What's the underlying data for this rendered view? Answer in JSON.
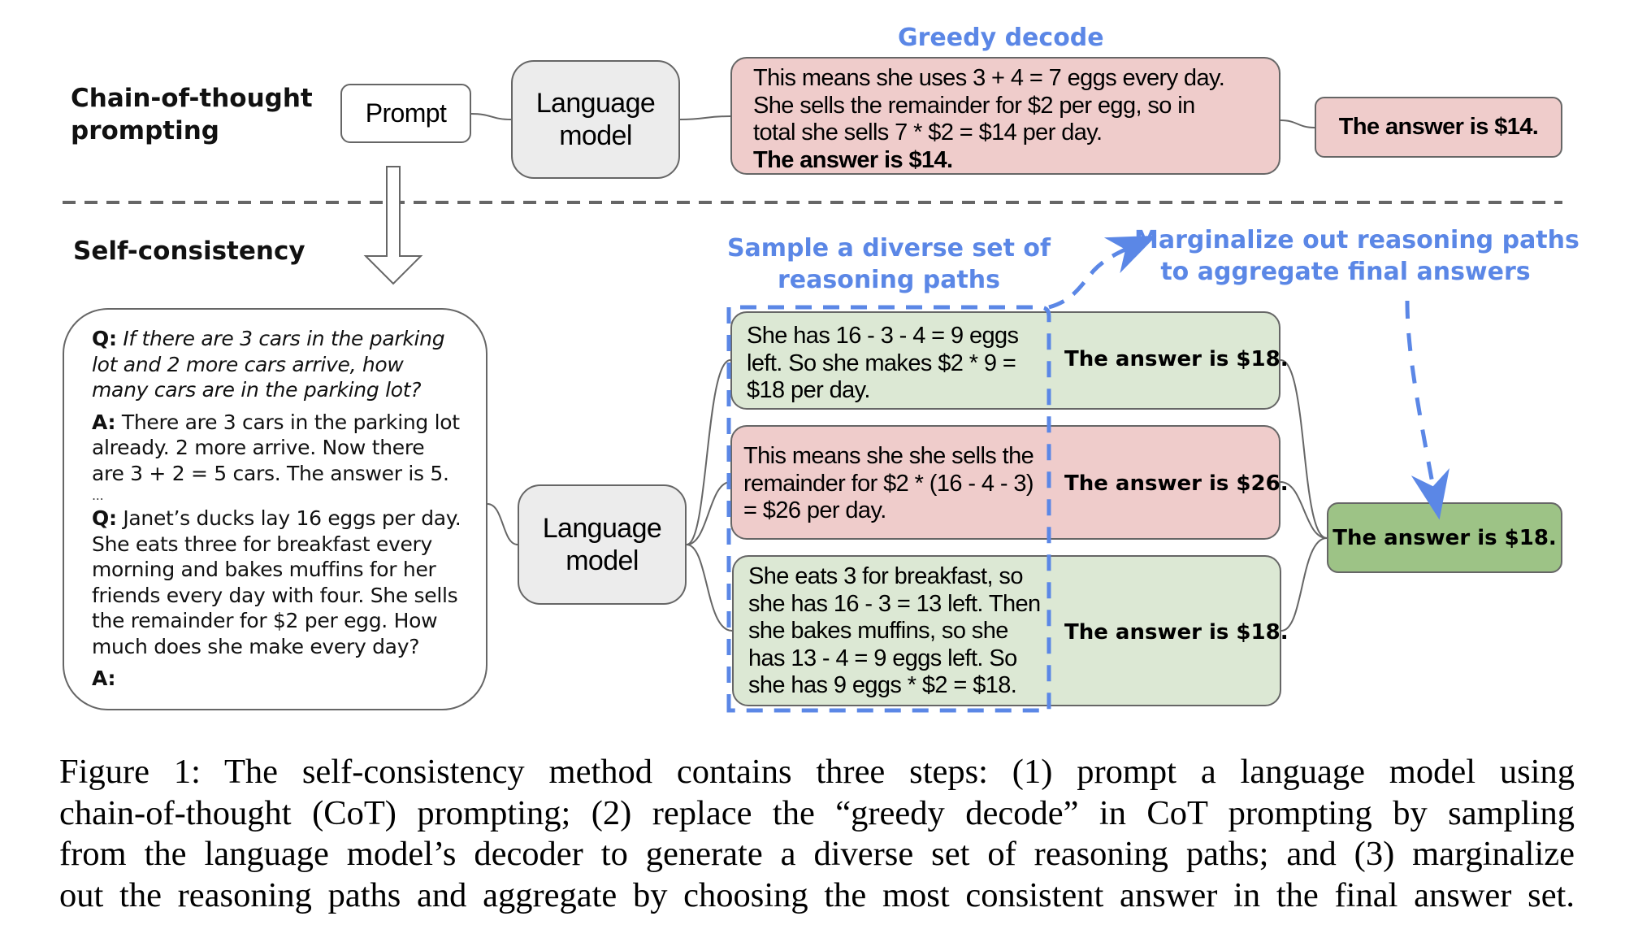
{
  "cot": {
    "label_line1": "Chain-of-thought",
    "label_line2": "prompting",
    "prompt_label": "Prompt",
    "lm_line1": "Language",
    "lm_line2": "model",
    "greedy_label": "Greedy decode",
    "greedy_lines": [
      "This means she uses 3 + 4 = 7 eggs every day.",
      "She sells the remainder for $2 per egg, so in",
      "total she sells 7 * $2 = $14 per day.",
      "The answer is $14."
    ],
    "answer": "The answer is $14."
  },
  "self_consistency": {
    "label": "Self-consistency",
    "prompt": {
      "q1_tag": "Q:",
      "q1_text": "If there are 3 cars in the parking lot and 2 more cars arrive, how many cars are in the parking lot?",
      "a1_tag": "A:",
      "a1_text": "There are 3 cars in the parking lot already. 2 more arrive. Now there are 3 + 2 = 5 cars. The answer is 5.",
      "ellipsis": "...",
      "q2_tag": "Q:",
      "q2_text": "Janet’s ducks lay 16 eggs per day. She eats three for breakfast every morning and bakes muffins for her friends every day with four. She sells the remainder for $2 per egg. How much does she make every day?",
      "a2_tag": "A:"
    },
    "lm_line1": "Language",
    "lm_line2": "model",
    "sample_label_line1": "Sample a diverse set of",
    "sample_label_line2": "reasoning paths",
    "marginalize_label_line1": "Marginalize out reasoning paths",
    "marginalize_label_line2": "to aggregate final answers",
    "paths": [
      {
        "lines": [
          "She has 16 - 3 - 4 = 9 eggs",
          "left. So she makes $2 * 9 =",
          "$18 per day."
        ],
        "answer": "The answer is $18.",
        "status": "correct"
      },
      {
        "lines": [
          "This means she she sells the",
          "remainder for $2 * (16 - 4 - 3)",
          "= $26 per day."
        ],
        "answer": "The answer is $26.",
        "status": "incorrect"
      },
      {
        "lines": [
          "She eats 3 for breakfast, so",
          "she has 16 - 3 = 13 left. Then",
          "she bakes muffins, so she",
          "has 13 - 4 = 9 eggs left. So",
          "she has 9 eggs * $2 = $18."
        ],
        "answer": "The answer is $18.",
        "status": "correct"
      }
    ],
    "final_answer": "The answer is $18."
  },
  "colors": {
    "accent_blue": "#5b87e6",
    "correct_fill": "#dce8d4",
    "incorrect_fill": "#efcccb",
    "final_fill": "#9dc386",
    "lm_fill": "#ececec",
    "border": "#666666"
  },
  "caption": {
    "lines": [
      "Figure 1: The self-consistency method contains three steps: (1) prompt a language model using",
      "chain-of-thought (CoT) prompting; (2) replace the “greedy decode” in CoT prompting by sampling",
      "from the language model’s decoder to generate a diverse set of reasoning paths; and (3) marginalize",
      "out the reasoning paths and aggregate by choosing the most consistent answer in the final answer set."
    ]
  }
}
